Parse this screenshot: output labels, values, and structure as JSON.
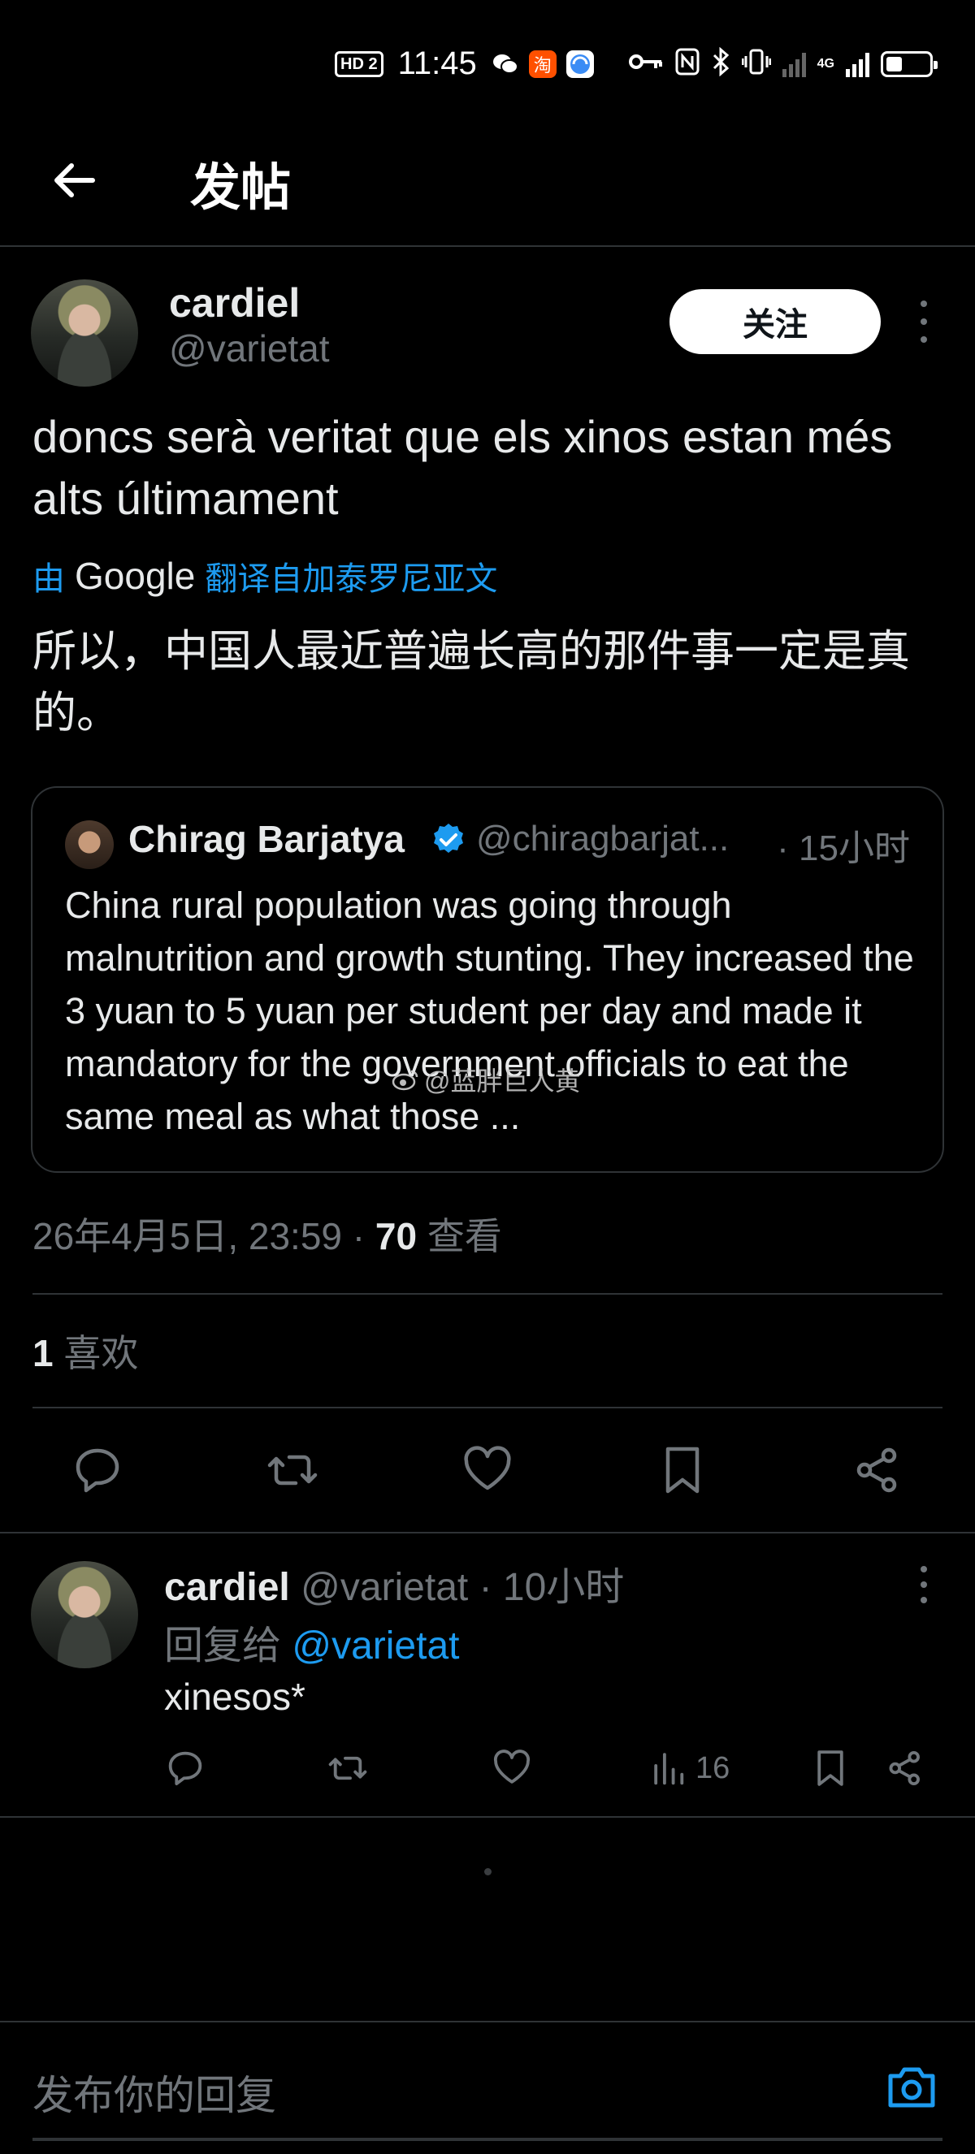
{
  "status_bar": {
    "hd_badge": "HD 2",
    "time": "11:45",
    "taobao_glyph": "淘",
    "network_badge": "4G"
  },
  "header": {
    "title": "发帖"
  },
  "tweet": {
    "author_name": "cardiel",
    "author_handle": "@varietat",
    "follow_label": "关注",
    "text": "doncs serà veritat que els xinos estan més alts últimament",
    "translated_by_prefix": "由",
    "translated_by_brand": "Google",
    "translated_from": "翻译自加泰罗尼亚文",
    "translated_text": "所以，中国人最近普遍长高的那件事一定是真的。",
    "quote": {
      "author_name": "Chirag Barjatya",
      "author_handle": "@chiragbarjat...",
      "time": "· 15小时",
      "text": "China rural population was going through malnutrition and growth stunting. They increased the 3 yuan to 5 yuan per student per day and made it mandatory for the government officials to eat the same meal as what those ..."
    },
    "timestamp": "26年4月5日, 23:59",
    "separator": " · ",
    "views_count": "70",
    "views_label": "查看",
    "likes_count": "1",
    "likes_label": "喜欢"
  },
  "watermark": "@蓝胖巨人黄",
  "reply": {
    "author_name": "cardiel",
    "author_handle": "@varietat",
    "time": "· 10小时",
    "reply_to_prefix": "回复给",
    "reply_to_handle": "@varietat",
    "text": "xinesos*",
    "views_count": "16"
  },
  "compose": {
    "placeholder": "发布你的回复"
  },
  "colors": {
    "background": "#000000",
    "accent": "#1d9bf0",
    "text_primary": "#e7e9ea",
    "text_secondary": "#71767b",
    "divider": "#2f3336"
  },
  "icons": {
    "back": "arrow-left-icon",
    "more": "more-vertical-icon",
    "verified": "verified-badge-icon",
    "reply": "reply-icon",
    "retweet": "retweet-icon",
    "like": "heart-icon",
    "bookmark": "bookmark-icon",
    "share": "share-icon",
    "views": "bar-chart-icon",
    "camera": "camera-icon",
    "weibo": "weibo-icon"
  }
}
